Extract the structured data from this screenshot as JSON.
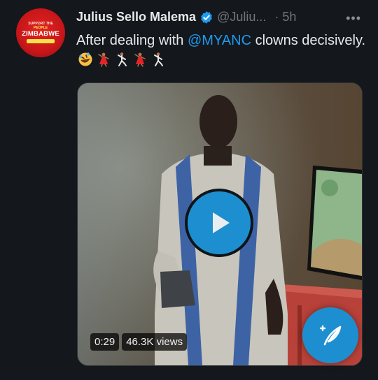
{
  "tweet": {
    "author_name": "Julius Sello Malema",
    "author_handle": "@Juliu...",
    "separator": "·",
    "timestamp": "5h",
    "more_label": "•••",
    "text_before": "After dealing with ",
    "mention": "@MYANC",
    "text_after": " clowns decisively. ",
    "emoji_icons": [
      "rolling-on-floor-laughing-emoji",
      "dancer-emoji",
      "man-dancing-emoji",
      "dancer-emoji",
      "man-dancing-emoji"
    ]
  },
  "avatar": {
    "line1": "SUPPORT THE",
    "line2": "PEOPLE",
    "line3": "ZIMBABWE"
  },
  "video": {
    "duration": "0:29",
    "views": "46.3K views"
  },
  "colors": {
    "accent": "#1d9bf0",
    "background": "#14171b",
    "play_button": "#1d8fd0",
    "verified": "#1d9bf0"
  }
}
